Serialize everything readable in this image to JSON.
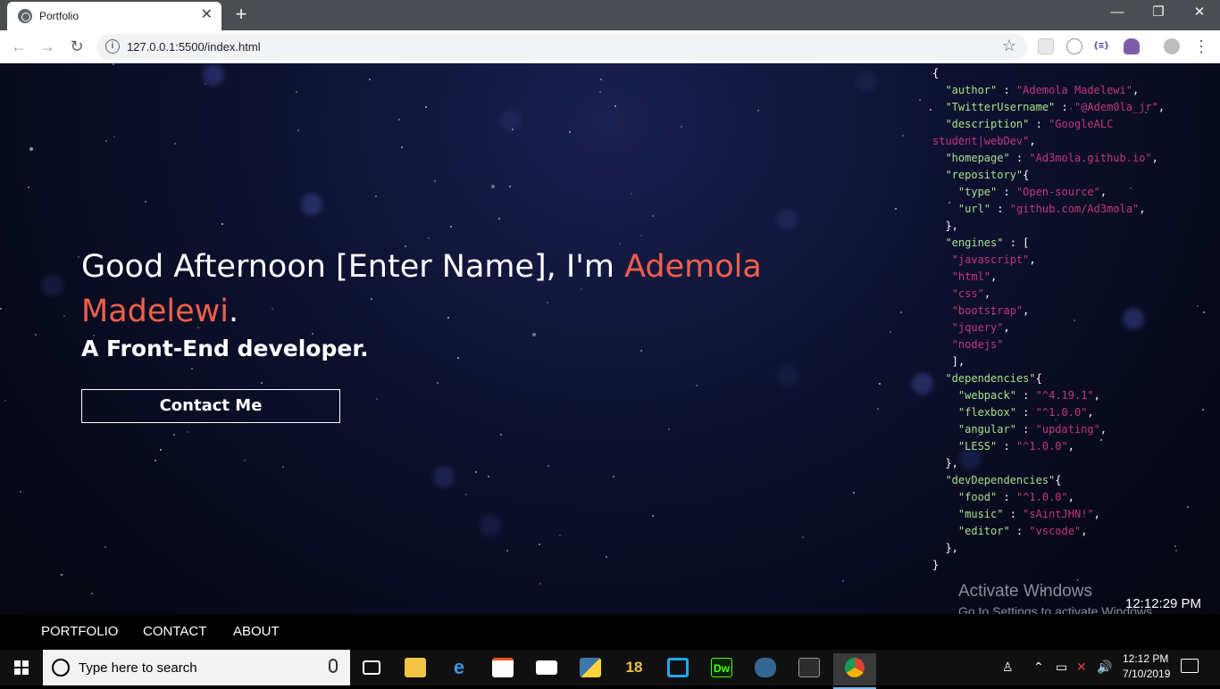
{
  "browser": {
    "tab_title": "Portfolio",
    "tab_close": "✕",
    "new_tab": "+",
    "url": "127.0.0.1:5500/index.html",
    "window_controls": {
      "minimize": "—",
      "restore": "❐",
      "close": "✕"
    },
    "nav": {
      "back": "←",
      "forward": "→",
      "reload": "↻"
    },
    "ext_icons": [
      "extension-icon",
      "extension-icon",
      "json-viewer-icon",
      "octocat-icon",
      "profile-icon",
      "menu-icon"
    ],
    "ext_texts": {
      "json": "{≡}",
      "menu": "⋮"
    }
  },
  "hero": {
    "greeting_prefix": "Good Afternoon [Enter Name], I'm ",
    "name": "Ademola Madelewi",
    "period": ".",
    "subtitle": "A Front-End developer.",
    "contact_button": "Contact Me"
  },
  "json_panel": {
    "lines": [
      [
        [
          "p",
          "{"
        ]
      ],
      [
        [
          "p",
          "  "
        ],
        [
          "k",
          "\"author\""
        ],
        [
          "p",
          " : "
        ],
        [
          "v",
          "\"Ademola Madelewi\""
        ],
        [
          "p",
          ","
        ]
      ],
      [
        [
          "p",
          "  "
        ],
        [
          "k",
          "\"TwitterUsername\""
        ],
        [
          "p",
          " : "
        ],
        [
          "v",
          "\"@Adem0la_jr\""
        ],
        [
          "p",
          ","
        ]
      ],
      [
        [
          "p",
          "  "
        ],
        [
          "k",
          "\"description\""
        ],
        [
          "p",
          " : "
        ],
        [
          "v",
          "\"GoogleALC"
        ]
      ],
      [
        [
          "v",
          "student|webDev\""
        ],
        [
          "p",
          ","
        ]
      ],
      [
        [
          "p",
          "  "
        ],
        [
          "k",
          "\"homepage\""
        ],
        [
          "p",
          " : "
        ],
        [
          "v",
          "\"Ad3mola.github.io\""
        ],
        [
          "p",
          ","
        ]
      ],
      [
        [
          "p",
          "  "
        ],
        [
          "k",
          "\"repository\""
        ],
        [
          "p",
          "{"
        ]
      ],
      [
        [
          "p",
          "    "
        ],
        [
          "k",
          "\"type\""
        ],
        [
          "p",
          " : "
        ],
        [
          "v",
          "\"Open-source\""
        ],
        [
          "p",
          ","
        ]
      ],
      [
        [
          "p",
          "    "
        ],
        [
          "k",
          "\"url\""
        ],
        [
          "p",
          " : "
        ],
        [
          "v",
          "\"github.com/Ad3mola\""
        ],
        [
          "p",
          ","
        ]
      ],
      [
        [
          "p",
          "  },"
        ]
      ],
      [
        [
          "p",
          "  "
        ],
        [
          "k",
          "\"engines\""
        ],
        [
          "p",
          " : ["
        ]
      ],
      [
        [
          "p",
          "   "
        ],
        [
          "v",
          "\"javascript\""
        ],
        [
          "p",
          ","
        ]
      ],
      [
        [
          "p",
          "   "
        ],
        [
          "v",
          "\"html\""
        ],
        [
          "p",
          ","
        ]
      ],
      [
        [
          "p",
          "   "
        ],
        [
          "v",
          "\"css\""
        ],
        [
          "p",
          ","
        ]
      ],
      [
        [
          "p",
          "   "
        ],
        [
          "v",
          "\"bootstrap\""
        ],
        [
          "p",
          ","
        ]
      ],
      [
        [
          "p",
          "   "
        ],
        [
          "v",
          "\"jquery\""
        ],
        [
          "p",
          ","
        ]
      ],
      [
        [
          "p",
          "   "
        ],
        [
          "v",
          "\"nodejs\""
        ]
      ],
      [
        [
          "p",
          "   ],"
        ]
      ],
      [
        [
          "p",
          "  "
        ],
        [
          "k",
          "\"dependencies\""
        ],
        [
          "p",
          "{"
        ]
      ],
      [
        [
          "p",
          "    "
        ],
        [
          "k",
          "\"webpack\""
        ],
        [
          "p",
          " : "
        ],
        [
          "v",
          "\"^4.19.1\""
        ],
        [
          "p",
          ","
        ]
      ],
      [
        [
          "p",
          "    "
        ],
        [
          "k",
          "\"flexbox\""
        ],
        [
          "p",
          " : "
        ],
        [
          "v",
          "\"^1.0.0\""
        ],
        [
          "p",
          ","
        ]
      ],
      [
        [
          "p",
          "    "
        ],
        [
          "k",
          "\"angular\""
        ],
        [
          "p",
          " : "
        ],
        [
          "v",
          "\"updating\""
        ],
        [
          "p",
          ","
        ]
      ],
      [
        [
          "p",
          "    "
        ],
        [
          "k",
          "\"LESS\""
        ],
        [
          "p",
          " : "
        ],
        [
          "v",
          "\"^1.0.0\""
        ],
        [
          "p",
          ","
        ]
      ],
      [
        [
          "p",
          "  },"
        ]
      ],
      [
        [
          "p",
          "  "
        ],
        [
          "k",
          "\"devDependencies\""
        ],
        [
          "p",
          "{"
        ]
      ],
      [
        [
          "p",
          "    "
        ],
        [
          "k",
          "\"food\""
        ],
        [
          "p",
          " : "
        ],
        [
          "v",
          "\"^1.0.0\""
        ],
        [
          "p",
          ","
        ]
      ],
      [
        [
          "p",
          "    "
        ],
        [
          "k",
          "\"music\""
        ],
        [
          "p",
          " : "
        ],
        [
          "v",
          "\"sAintJHN!\""
        ],
        [
          "p",
          ","
        ]
      ],
      [
        [
          "p",
          "    "
        ],
        [
          "k",
          "\"editor\""
        ],
        [
          "p",
          " : "
        ],
        [
          "v",
          "\"vscode\""
        ],
        [
          "p",
          ","
        ]
      ],
      [
        [
          "p",
          "  },"
        ]
      ],
      [
        [
          "p",
          "}"
        ]
      ]
    ],
    "colors": {
      "key": "#a8e08a",
      "value": "#c2367f"
    }
  },
  "activation": {
    "title": "Activate Windows",
    "subtitle": "Go to Settings to activate Windows."
  },
  "page_clock": "12:12:29 PM",
  "page_nav": [
    "PORTFOLIO",
    "CONTACT",
    "ABOUT"
  ],
  "taskbar": {
    "search_placeholder": "Type here to search",
    "apps": [
      {
        "name": "task-view-icon",
        "label": ""
      },
      {
        "name": "file-explorer-icon",
        "label": ""
      },
      {
        "name": "edge-icon",
        "label": "e"
      },
      {
        "name": "store-icon",
        "label": ""
      },
      {
        "name": "mail-icon",
        "label": ""
      },
      {
        "name": "python-icon",
        "label": ""
      },
      {
        "name": "app-18-icon",
        "label": "18"
      },
      {
        "name": "vscode-icon",
        "label": ""
      },
      {
        "name": "dreamweaver-icon",
        "label": "Dw"
      },
      {
        "name": "postgresql-icon",
        "label": ""
      },
      {
        "name": "mysql-icon",
        "label": ""
      },
      {
        "name": "chrome-icon",
        "label": ""
      }
    ],
    "tray_time": "12:12 PM",
    "tray_date": "7/10/2019"
  },
  "accent_color": "#f0604a"
}
